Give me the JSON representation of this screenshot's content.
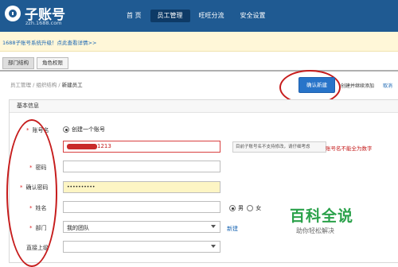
{
  "header": {
    "logo_title": "子账号",
    "logo_subtitle": "zzh.1688.com",
    "nav": [
      "首 页",
      "员工管理",
      "旺旺分流",
      "安全设置"
    ],
    "active_nav": "员工管理"
  },
  "notice": {
    "text": "1688子账号系统升级！点此查看详情>>"
  },
  "tabs": [
    "部门结构",
    "角色权限"
  ],
  "breadcrumb": {
    "part1": "员工管理",
    "part2": "组织结构",
    "current": "新建员工"
  },
  "actions": {
    "confirm": "确认新建",
    "create_continue": "创建并继续添加",
    "cancel": "取消"
  },
  "panel": {
    "title": "基本信息"
  },
  "form": {
    "account_label": "账号名",
    "create_account_option": "创建一个账号",
    "account_value_visible": "1213",
    "account_hint": "目前子账号名不支持修改，请仔细考虑",
    "account_error": "账号名不能全为数字",
    "password_label": "密码",
    "confirm_password_label": "确认密码",
    "confirm_password_value": "••••••••••",
    "name_label": "姓名",
    "gender_male": "男",
    "gender_female": "女",
    "dept_label": "部门",
    "dept_value": "我的团队",
    "new_dept_link": "新建",
    "superior_label": "直接上级"
  },
  "watermark": {
    "title": "百科全说",
    "subtitle": "助你轻松解决"
  },
  "colors": {
    "header_bg": "#1f5a92",
    "accent": "#2874c9",
    "highlight": "#c61c1c",
    "watermark": "#2aa14a"
  }
}
